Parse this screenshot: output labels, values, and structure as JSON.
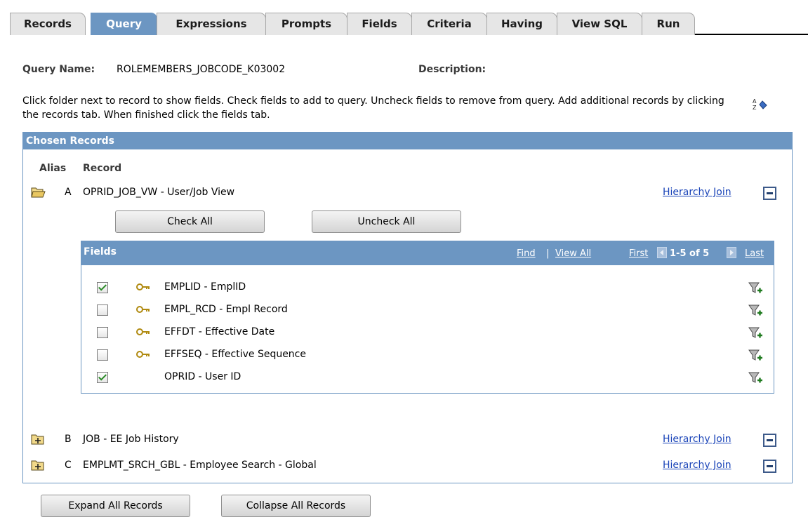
{
  "tabs": [
    {
      "label": "Records"
    },
    {
      "label": "Query"
    },
    {
      "label": "Expressions"
    },
    {
      "label": "Prompts"
    },
    {
      "label": "Fields"
    },
    {
      "label": "Criteria"
    },
    {
      "label": "Having"
    },
    {
      "label": "View SQL"
    },
    {
      "label": "Run"
    }
  ],
  "active_tab": "Query",
  "query": {
    "name_label": "Query Name:",
    "name_value": "ROLEMEMBERS_JOBCODE_K03002",
    "description_label": "Description:"
  },
  "instructions": "Click folder next to record to show fields. Check fields to add to query. Uncheck fields to remove from query. Add additional records by clicking the records tab. When finished click the fields tab.",
  "chosen_records": {
    "title": "Chosen Records",
    "col_alias": "Alias",
    "col_record": "Record",
    "hierarchy_join_label": "Hierarchy Join",
    "records": [
      {
        "alias": "A",
        "name": "OPRID_JOB_VW - User/Job View",
        "expanded": true
      },
      {
        "alias": "B",
        "name": "JOB - EE Job History",
        "expanded": false
      },
      {
        "alias": "C",
        "name": "EMPLMT_SRCH_GBL - Employee Search - Global",
        "expanded": false
      }
    ]
  },
  "buttons": {
    "check_all": "Check All",
    "uncheck_all": "Uncheck All",
    "expand_all": "Expand All Records",
    "collapse_all": "Collapse All Records"
  },
  "fields_grid": {
    "title": "Fields",
    "find": "Find",
    "separator": "|",
    "view_all": "View All",
    "first": "First",
    "count": "1-5 of 5",
    "last": "Last",
    "rows": [
      {
        "name": "EMPLID - EmplID",
        "checked": true,
        "key": true
      },
      {
        "name": "EMPL_RCD - Empl Record",
        "checked": false,
        "key": true
      },
      {
        "name": "EFFDT - Effective Date",
        "checked": false,
        "key": true
      },
      {
        "name": "EFFSEQ - Effective Sequence",
        "checked": false,
        "key": true
      },
      {
        "name": "OPRID - User ID",
        "checked": true,
        "key": false
      }
    ]
  },
  "colors": {
    "header_blue": "#6c96c2",
    "link_blue": "#1a44b8",
    "tab_gray": "#e6e6e6"
  },
  "icons": {
    "spell_check": "spell-check-icon",
    "open_folder": "folder-open-icon",
    "closed_folder": "folder-plus-icon",
    "key": "key-icon",
    "criteria": "funnel-plus-icon",
    "remove": "minus-icon"
  }
}
